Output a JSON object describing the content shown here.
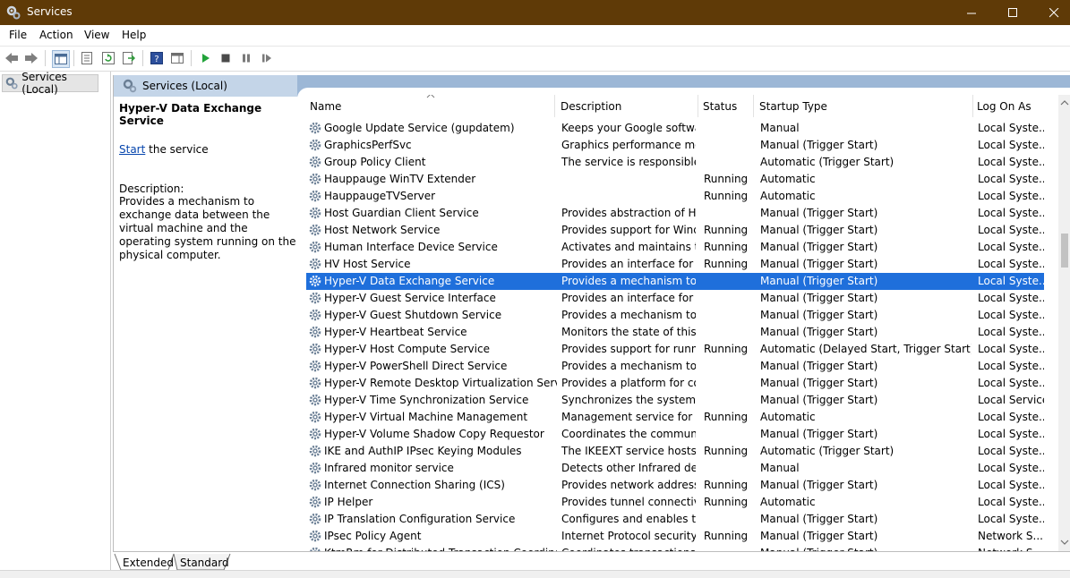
{
  "window": {
    "title": "Services"
  },
  "menu": [
    "File",
    "Action",
    "View",
    "Help"
  ],
  "tree": {
    "root_label": "Services (Local)"
  },
  "content": {
    "header_label": "Services (Local)"
  },
  "details": {
    "service_name": "Hyper-V Data Exchange Service",
    "start_link": "Start",
    "start_suffix": " the service",
    "description_label": "Description:",
    "description_text": "Provides a mechanism to exchange data between the virtual machine and the operating system running on the physical computer."
  },
  "table": {
    "columns": [
      "Name",
      "Description",
      "Status",
      "Startup Type",
      "Log On As"
    ],
    "selected_index": 9,
    "rows": [
      {
        "name": "Google Update Service (gupdatem)",
        "description": "Keeps your Google softwa...",
        "status": "",
        "startup": "Manual",
        "logon": "Local Syste..."
      },
      {
        "name": "GraphicsPerfSvc",
        "description": "Graphics performance mo...",
        "status": "",
        "startup": "Manual (Trigger Start)",
        "logon": "Local Syste..."
      },
      {
        "name": "Group Policy Client",
        "description": "The service is responsible ...",
        "status": "",
        "startup": "Automatic (Trigger Start)",
        "logon": "Local Syste..."
      },
      {
        "name": "Hauppauge WinTV Extender",
        "description": "",
        "status": "Running",
        "startup": "Automatic",
        "logon": "Local Syste..."
      },
      {
        "name": "HauppaugeTVServer",
        "description": "",
        "status": "Running",
        "startup": "Automatic",
        "logon": "Local Syste..."
      },
      {
        "name": "Host Guardian Client Service",
        "description": "Provides abstraction of H...",
        "status": "",
        "startup": "Manual (Trigger Start)",
        "logon": "Local Syste..."
      },
      {
        "name": "Host Network Service",
        "description": "Provides support for Wind...",
        "status": "Running",
        "startup": "Manual (Trigger Start)",
        "logon": "Local Syste..."
      },
      {
        "name": "Human Interface Device Service",
        "description": "Activates and maintains t...",
        "status": "Running",
        "startup": "Manual (Trigger Start)",
        "logon": "Local Syste..."
      },
      {
        "name": "HV Host Service",
        "description": "Provides an interface for t...",
        "status": "Running",
        "startup": "Manual (Trigger Start)",
        "logon": "Local Syste..."
      },
      {
        "name": "Hyper-V Data Exchange Service",
        "description": "Provides a mechanism to ...",
        "status": "",
        "startup": "Manual (Trigger Start)",
        "logon": "Local Syste..."
      },
      {
        "name": "Hyper-V Guest Service Interface",
        "description": "Provides an interface for t...",
        "status": "",
        "startup": "Manual (Trigger Start)",
        "logon": "Local Syste..."
      },
      {
        "name": "Hyper-V Guest Shutdown Service",
        "description": "Provides a mechanism to ...",
        "status": "",
        "startup": "Manual (Trigger Start)",
        "logon": "Local Syste..."
      },
      {
        "name": "Hyper-V Heartbeat Service",
        "description": "Monitors the state of this ...",
        "status": "",
        "startup": "Manual (Trigger Start)",
        "logon": "Local Syste..."
      },
      {
        "name": "Hyper-V Host Compute Service",
        "description": "Provides support for runni...",
        "status": "Running",
        "startup": "Automatic (Delayed Start, Trigger Start)",
        "logon": "Local Syste..."
      },
      {
        "name": "Hyper-V PowerShell Direct Service",
        "description": "Provides a mechanism to ...",
        "status": "",
        "startup": "Manual (Trigger Start)",
        "logon": "Local Syste..."
      },
      {
        "name": "Hyper-V Remote Desktop Virtualization Service",
        "description": "Provides a platform for co...",
        "status": "",
        "startup": "Manual (Trigger Start)",
        "logon": "Local Syste..."
      },
      {
        "name": "Hyper-V Time Synchronization Service",
        "description": "Synchronizes the system t...",
        "status": "",
        "startup": "Manual (Trigger Start)",
        "logon": "Local Service"
      },
      {
        "name": "Hyper-V Virtual Machine Management",
        "description": "Management service for ...",
        "status": "Running",
        "startup": "Automatic",
        "logon": "Local Syste..."
      },
      {
        "name": "Hyper-V Volume Shadow Copy Requestor",
        "description": "Coordinates the commun...",
        "status": "",
        "startup": "Manual (Trigger Start)",
        "logon": "Local Syste..."
      },
      {
        "name": "IKE and AuthIP IPsec Keying Modules",
        "description": "The IKEEXT service hosts t...",
        "status": "Running",
        "startup": "Automatic (Trigger Start)",
        "logon": "Local Syste..."
      },
      {
        "name": "Infrared monitor service",
        "description": "Detects other Infrared dev...",
        "status": "",
        "startup": "Manual",
        "logon": "Local Syste..."
      },
      {
        "name": "Internet Connection Sharing (ICS)",
        "description": "Provides network address ...",
        "status": "Running",
        "startup": "Manual (Trigger Start)",
        "logon": "Local Syste..."
      },
      {
        "name": "IP Helper",
        "description": "Provides tunnel connectiv...",
        "status": "Running",
        "startup": "Automatic",
        "logon": "Local Syste..."
      },
      {
        "name": "IP Translation Configuration Service",
        "description": "Configures and enables tr...",
        "status": "",
        "startup": "Manual (Trigger Start)",
        "logon": "Local Syste..."
      },
      {
        "name": "IPsec Policy Agent",
        "description": "Internet Protocol security ...",
        "status": "Running",
        "startup": "Manual (Trigger Start)",
        "logon": "Network S..."
      },
      {
        "name": "KtmRm for Distributed Transaction Coordinator",
        "description": "Coordinates transactions ...",
        "status": "",
        "startup": "Manual (Trigger Start)",
        "logon": "Network S..."
      }
    ]
  },
  "tabs": [
    "Extended",
    "Standard"
  ],
  "colors": {
    "titlebar": "#5f3a07",
    "selection": "#1f6fdb",
    "header": "#9cb7d6",
    "link": "#0645ad"
  }
}
